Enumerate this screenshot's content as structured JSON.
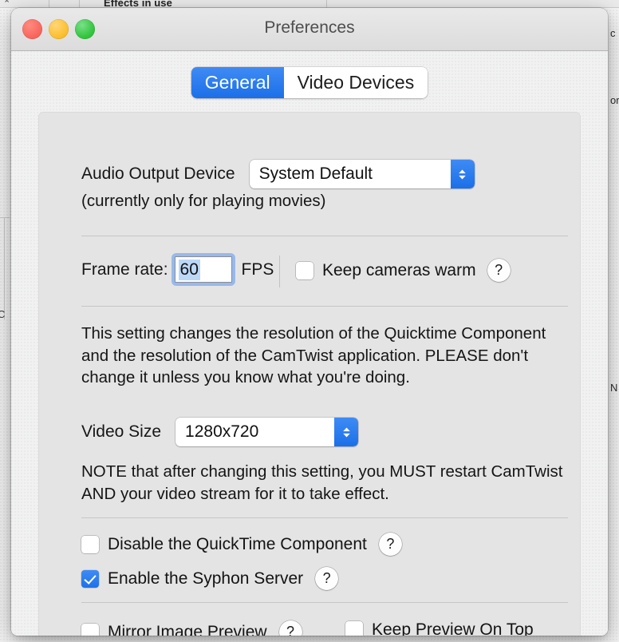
{
  "background_app": {
    "header_label": "Effects in use",
    "right_edge_fragments": [
      "c",
      "or",
      "N"
    ],
    "left_edge_fragment": "C",
    "toolbar_chevron": "⌃"
  },
  "dialog": {
    "title": "Preferences",
    "traffic_lights": {
      "close": "close-button",
      "minimize": "minimize-button",
      "zoom": "zoom-button"
    },
    "tabs": [
      {
        "label": "General",
        "active": true
      },
      {
        "label": "Video Devices",
        "active": false
      }
    ],
    "audio": {
      "label": "Audio Output Device",
      "selected": "System Default",
      "options": [
        "System Default"
      ],
      "note": "(currently only for playing movies)"
    },
    "frame_rate": {
      "label": "Frame rate:",
      "value": "60",
      "unit": "FPS",
      "keep_cameras_warm": {
        "label": "Keep cameras warm",
        "checked": false,
        "help": "?"
      }
    },
    "resolution_note": "This setting changes the resolution of the Quicktime Component and the resolution of the CamTwist application.  PLEASE don't change it unless you know what you're doing.",
    "video_size": {
      "label": "Video Size",
      "selected": "1280x720",
      "options": [
        "1280x720"
      ]
    },
    "restart_note": "NOTE that after changing this setting, you MUST restart CamTwist AND your video stream for it to take effect.",
    "checkboxes": [
      {
        "label": "Disable the QuickTime Component",
        "checked": false,
        "help": "?"
      },
      {
        "label": "Enable the Syphon Server",
        "checked": true,
        "help": "?"
      },
      {
        "label": "Mirror Image Preview",
        "checked": false,
        "help": "?"
      },
      {
        "label": "Keep Preview On Top",
        "checked": false,
        "help": null
      }
    ]
  },
  "colors": {
    "accent_blue": "#1b6fe8",
    "tab_active_blue": "#1f76eb",
    "selection_blue": "#bcd8f7",
    "traffic_red": "#f9675e",
    "traffic_yellow": "#fcc02f",
    "traffic_green": "#34c53f",
    "panel_bg": "#e4e4e4",
    "dialog_bg": "#f1f1f1",
    "titlebar_bg": "#e2e2e2"
  }
}
